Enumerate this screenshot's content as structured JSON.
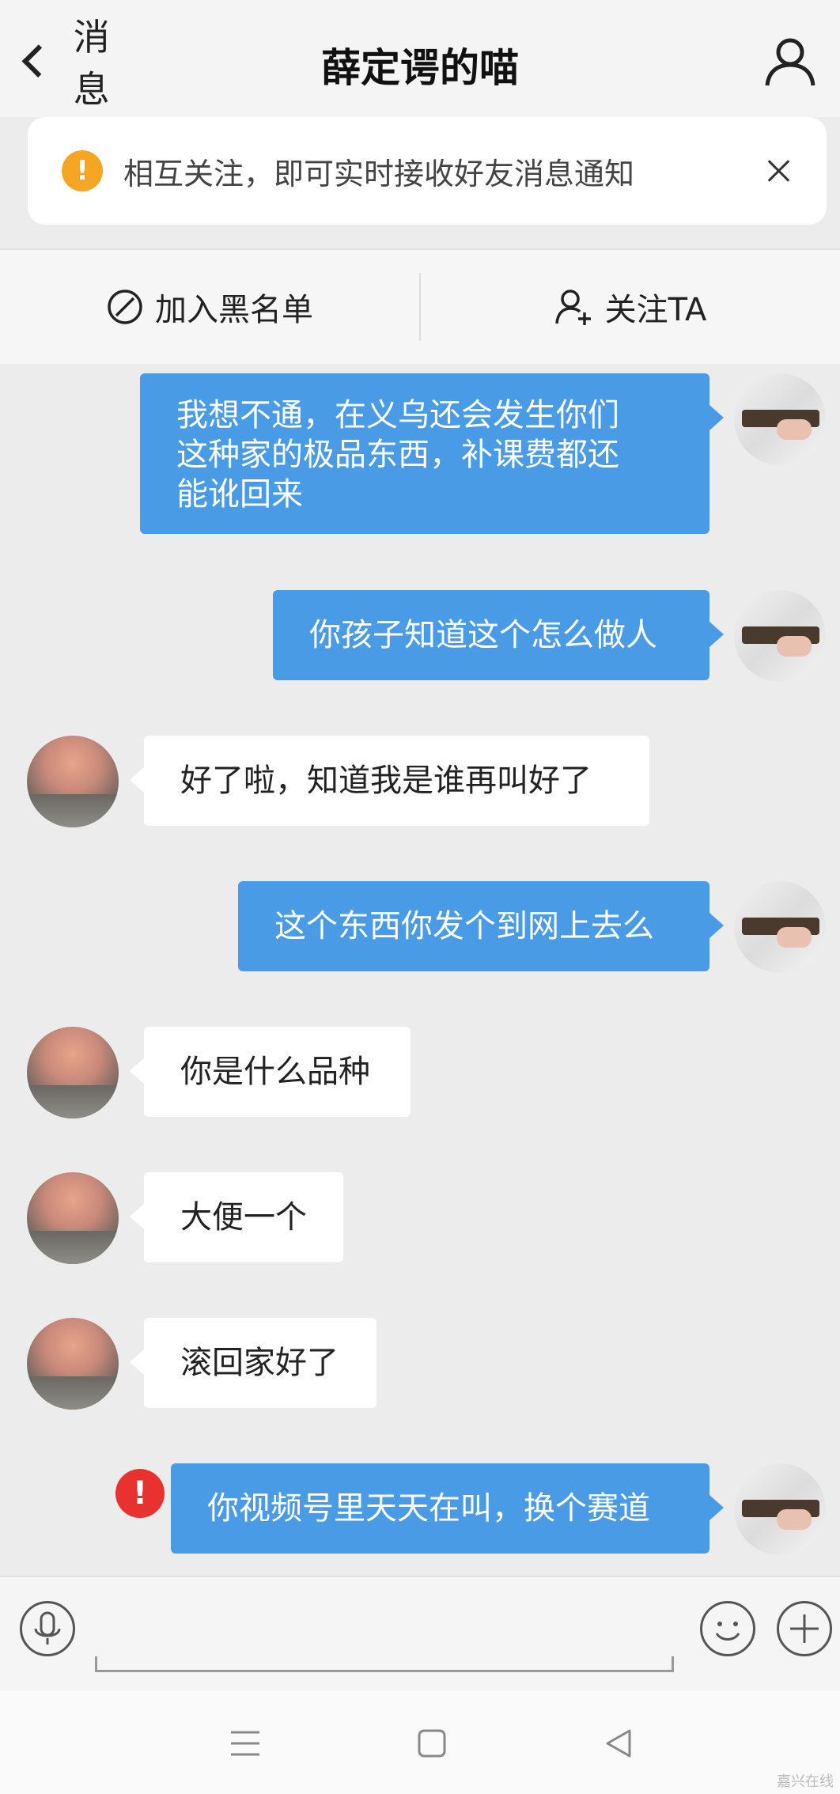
{
  "header": {
    "back_label": "消息",
    "title": "薛定谔的喵"
  },
  "notice": {
    "text": "相互关注，即可实时接收好友消息通知",
    "icon": "warning-icon",
    "accent": "#f5a623"
  },
  "actions": {
    "block_label": "加入黑名单",
    "follow_label": "关注TA"
  },
  "messages": [
    {
      "side": "out",
      "lines": [
        "我想不通，在义乌还会发生你们",
        "这种家的极品东西，补课费都还",
        "能讹回来"
      ]
    },
    {
      "side": "out",
      "text": "你孩子知道这个怎么做人"
    },
    {
      "side": "in",
      "text": "好了啦，知道我是谁再叫好了"
    },
    {
      "side": "out",
      "text": "这个东西你发个到网上去么"
    },
    {
      "side": "in",
      "text": "你是什么品种"
    },
    {
      "side": "in",
      "text": "大便一个"
    },
    {
      "side": "in",
      "text": "滚回家好了"
    },
    {
      "side": "out",
      "text": "你视频号里天天在叫，换个赛道",
      "status": "failed"
    }
  ],
  "colors": {
    "outgoing_bubble": "#4a9be6",
    "incoming_bubble": "#ffffff",
    "error": "#e8322f"
  },
  "error_mark": "!",
  "notice_mark": "!",
  "watermark": "嘉兴在线"
}
